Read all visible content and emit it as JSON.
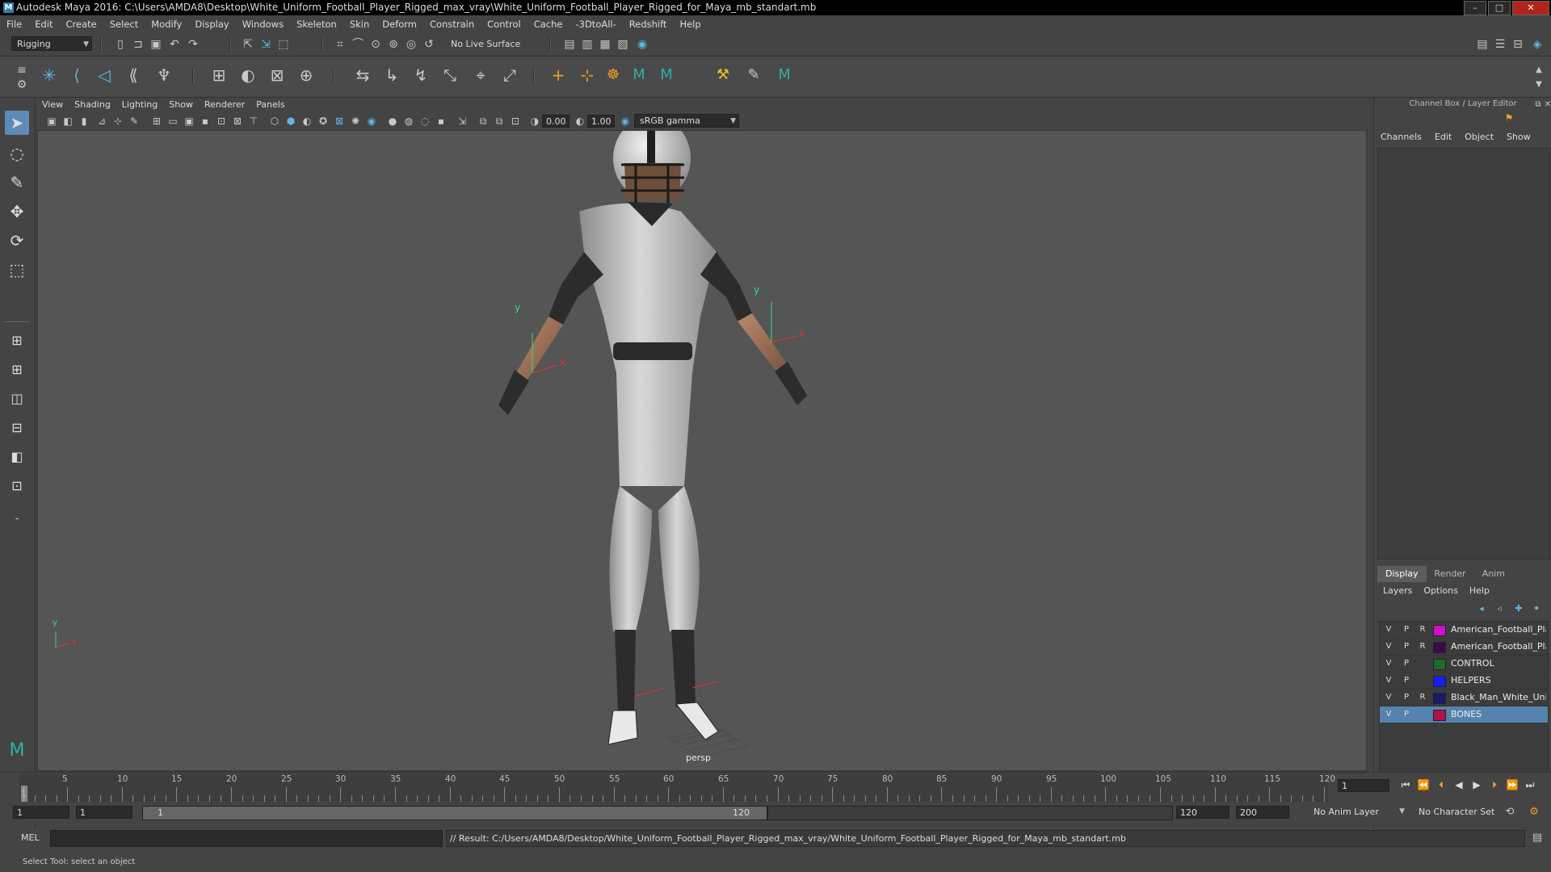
{
  "window": {
    "title": "Autodesk Maya 2016: C:\\Users\\AMDA8\\Desktop\\White_Uniform_Football_Player_Rigged_max_vray\\White_Uniform_Football_Player_Rigged_for_Maya_mb_standart.mb",
    "logo": "M",
    "minimize": "–",
    "maximize": "□",
    "close": "✕"
  },
  "menubar": [
    "File",
    "Edit",
    "Create",
    "Select",
    "Modify",
    "Display",
    "Windows",
    "Skeleton",
    "Skin",
    "Deform",
    "Constrain",
    "Control",
    "Cache",
    "-3DtoAll-",
    "Redshift",
    "Help"
  ],
  "status_line": {
    "menuset": "Rigging",
    "live_surface": "No Live Surface"
  },
  "panel_menu": [
    "View",
    "Shading",
    "Lighting",
    "Show",
    "Renderer",
    "Panels"
  ],
  "panel_toolbar": {
    "exposure": "0.00",
    "gamma": "1.00",
    "color_space": "sRGB gamma"
  },
  "viewport": {
    "camera_label": "persp",
    "axis_y": "y",
    "axis_x": "x"
  },
  "channel_box": {
    "title": "Channel Box / Layer Editor",
    "menu": [
      "Channels",
      "Edit",
      "Object",
      "Show"
    ],
    "tabs": [
      "Display",
      "Render",
      "Anim"
    ],
    "active_tab": "Display",
    "layer_menu": [
      "Layers",
      "Options",
      "Help"
    ],
    "layers": [
      {
        "v": "V",
        "p": "P",
        "r": "R",
        "color": "#d010c8",
        "name": "American_Football_Player"
      },
      {
        "v": "V",
        "p": "P",
        "r": "R",
        "color": "#3a0a4a",
        "name": "American_Football_Player_"
      },
      {
        "v": "V",
        "p": "P",
        "r": "",
        "color": "#1f6b2a",
        "name": "CONTROL"
      },
      {
        "v": "V",
        "p": "P",
        "r": "",
        "color": "#1a1aff",
        "name": "HELPERS"
      },
      {
        "v": "V",
        "p": "P",
        "r": "R",
        "color": "#1a1a6a",
        "name": "Black_Man_White_Uniform_Hel"
      },
      {
        "v": "V",
        "p": "P",
        "r": "",
        "color": "#b0124a",
        "name": "BONES"
      }
    ]
  },
  "timeline": {
    "ticks": [
      "5",
      "10",
      "15",
      "20",
      "25",
      "30",
      "35",
      "40",
      "45",
      "50",
      "55",
      "60",
      "65",
      "70",
      "75",
      "80",
      "85",
      "90",
      "95",
      "100",
      "105",
      "110",
      "115",
      "120"
    ],
    "current_frame": "1",
    "first_tick": "1"
  },
  "range": {
    "start_field": "1",
    "start_field2": "1",
    "range_start": "1",
    "range_end": "120",
    "end_field": "120",
    "end_field2": "200",
    "anim_layer": "No Anim Layer",
    "char_set": "No Character Set"
  },
  "command": {
    "mode": "MEL",
    "result": "// Result: C:/Users/AMDA8/Desktop/White_Uniform_Football_Player_Rigged_max_vray/White_Uniform_Football_Player_Rigged_for_Maya_mb_standart.mb"
  },
  "help_line": "Select Tool: select an object"
}
